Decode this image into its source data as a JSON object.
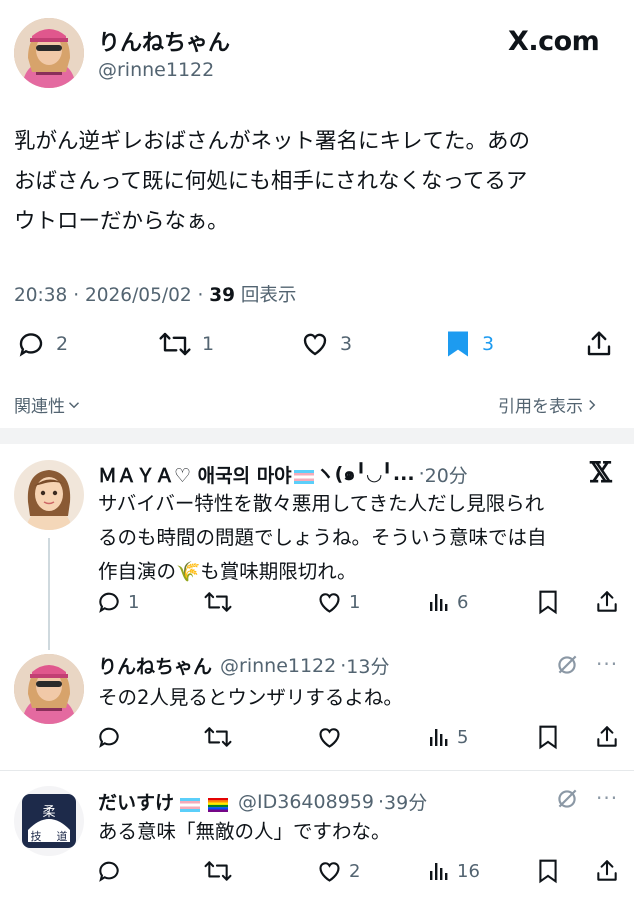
{
  "main_post": {
    "author_name": "りんねちゃん",
    "author_handle": "@rinne1122",
    "brand": "X.com",
    "text_lines": [
      "乳がん逆ギレおばさんがネット署名にキレてた。あの",
      "おばさんって既に何処にも相手にされなくなってるア",
      "ウトローだからなぁ。"
    ],
    "time": "20:38",
    "date": "2026/05/02",
    "views": "39",
    "views_label": "回表示",
    "replies": "2",
    "reposts": "1",
    "likes": "3",
    "bookmarks": "3",
    "relevance_label": "関連性",
    "quotes_label": "引用を表示"
  },
  "replies": [
    {
      "name": "ＭＡＹＡ♡ 애국의 마야",
      "name_suffix": "ヽ(๑╹◡╹...",
      "time": "20分",
      "text_lines": [
        "サバイバー特性を散々悪用してきた人だし見限られ",
        "るのも時間の問題でしょうね。そういう意味では自",
        "作自演の🌾も賞味期限切れ。"
      ],
      "replies": "1",
      "reposts": "",
      "likes": "1",
      "views": "6"
    },
    {
      "name": "りんねちゃん",
      "handle": "@rinne1122",
      "time": "13分",
      "text_lines": [
        "その2人見るとウンザリするよね。"
      ],
      "replies": "",
      "reposts": "",
      "likes": "",
      "views": "5"
    },
    {
      "name": "だいすけ",
      "handle": "@ID36408959",
      "time": "39分",
      "text_lines": [
        "ある意味「無敵の人」ですわな。"
      ],
      "replies": "",
      "reposts": "",
      "likes": "2",
      "views": "16"
    }
  ],
  "colors": {
    "accent": "#1d9bf0",
    "text": "#0f1419",
    "muted": "#536471"
  }
}
